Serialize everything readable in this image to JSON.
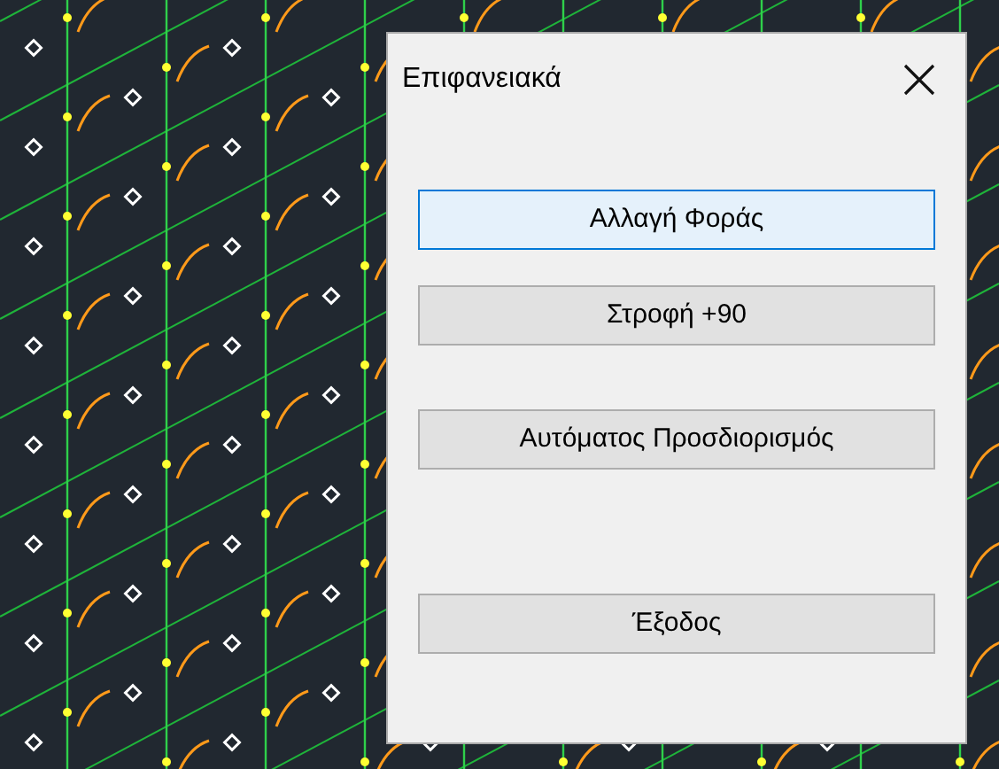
{
  "dialog": {
    "title": "Επιφανειακά",
    "buttons": [
      {
        "label": "Αλλαγή Φοράς",
        "hovered": true
      },
      {
        "label": "Στροφή +90",
        "hovered": false
      },
      {
        "label": "Αυτόματος Προσδιορισμός",
        "hovered": false
      },
      {
        "label": "Έξοδος",
        "hovered": false
      }
    ]
  }
}
